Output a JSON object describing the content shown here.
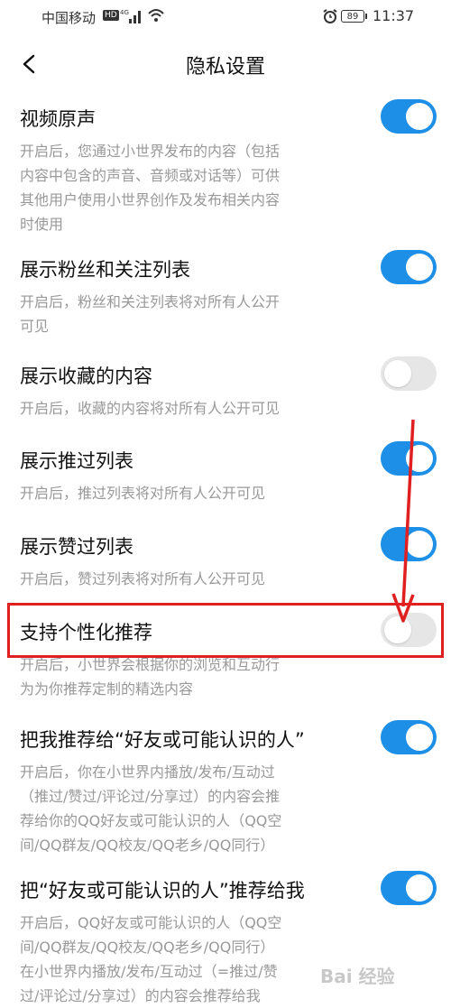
{
  "status_bar": {
    "carrier": "中国移动",
    "hd": "HD",
    "network": "4G",
    "battery": "89",
    "time": "11:37"
  },
  "header": {
    "title": "隐私设置"
  },
  "settings": [
    {
      "label": "视频原声",
      "state": "on",
      "desc": [
        "开启后，您通过小世界发布的内容（包括",
        "内容中包含的声音、音频或对话等）可供",
        "其他用户使用小世界创作及发布相关内容",
        "时使用"
      ]
    },
    {
      "label": "展示粉丝和关注列表",
      "state": "on",
      "desc": [
        "开启后，粉丝和关注列表将对所有人公开",
        "可见"
      ]
    },
    {
      "label": "展示收藏的内容",
      "state": "off",
      "desc": [
        "开启后，收藏的内容将对所有人公开可见"
      ]
    },
    {
      "label": "展示推过列表",
      "state": "on",
      "desc": [
        "开启后，推过列表将对所有人公开可见"
      ]
    },
    {
      "label": "展示赞过列表",
      "state": "on",
      "desc": [
        "开启后，赞过列表将对所有人公开可见"
      ]
    },
    {
      "label": "支持个性化推荐",
      "state": "off",
      "desc": [
        "开启后，小世界会根据你的浏览和互动行",
        "为为你推荐定制的精选内容"
      ]
    },
    {
      "label": "把我推荐给“好友或可能认识的人”",
      "state": "on",
      "desc": [
        "开启后，你在小世界内播放/发布/互动过",
        "（推过/赞过/评论过/分享过）的内容会推",
        "荐给你的QQ好友或可能认识的人（QQ空",
        "间/QQ群友/QQ校友/QQ老乡/QQ同行）"
      ]
    },
    {
      "label": "把“好友或可能认识的人”推荐给我",
      "state": "on",
      "desc": [
        "开启后，QQ好友或可能认识的人（QQ空",
        "间/QQ群友/QQ校友/QQ老乡/QQ同行）",
        "在小世界内播放/发布/互动过（=推过/赞",
        "过/评论过/分享过）的内容会推荐给我"
      ]
    }
  ],
  "colors": {
    "toggle_on": "#1e8fe6",
    "toggle_off": "#e6e6e6",
    "annotation": "#e02020"
  },
  "watermark": "Bai 经验"
}
